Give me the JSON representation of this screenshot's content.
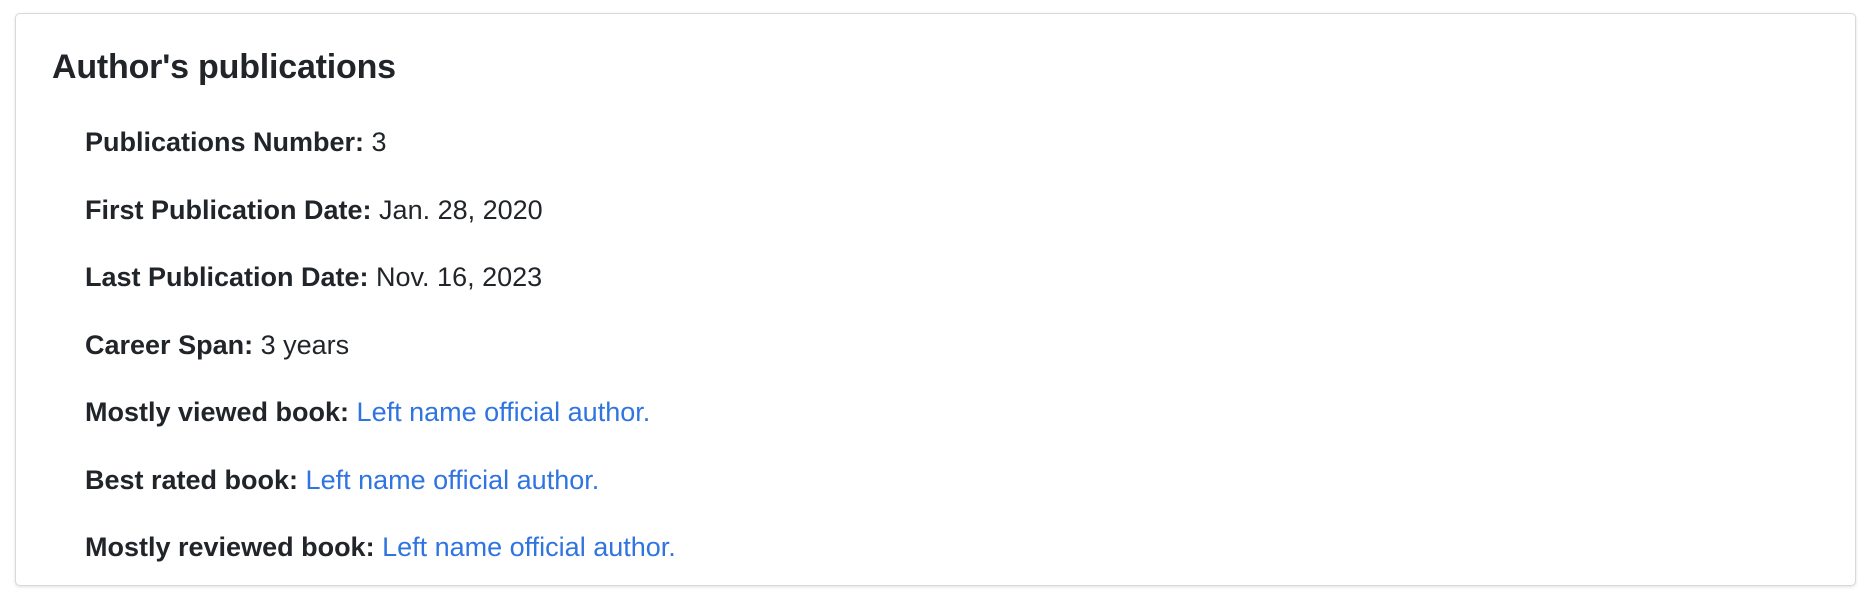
{
  "card": {
    "title": "Author's publications",
    "rows": [
      {
        "label": "Publications Number:",
        "value": "3"
      },
      {
        "label": "First Publication Date:",
        "value": "Jan. 28, 2020"
      },
      {
        "label": "Last Publication Date:",
        "value": "Nov. 16, 2023"
      },
      {
        "label": "Career Span:",
        "value": "3 years"
      },
      {
        "label": "Mostly viewed book:",
        "link": "Left name official author."
      },
      {
        "label": "Best rated book:",
        "link": "Left name official author."
      },
      {
        "label": "Mostly reviewed book:",
        "link": "Left name official author."
      }
    ]
  },
  "colors": {
    "text": "#212529",
    "link": "#2f74e0",
    "border": "#d9d9d9",
    "background": "#ffffff"
  }
}
